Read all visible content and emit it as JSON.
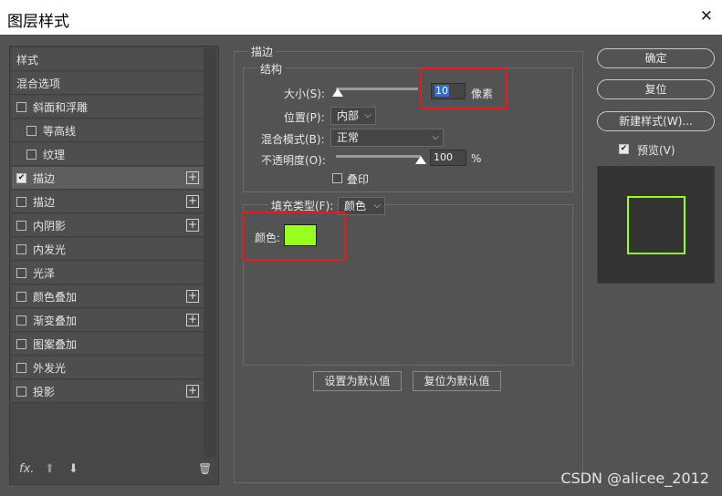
{
  "window": {
    "title": "图层样式",
    "close_glyph": "✕"
  },
  "sidebar": {
    "items": [
      {
        "label": "样式",
        "has_checkbox": false,
        "checked": false,
        "has_plus": false
      },
      {
        "label": "混合选项",
        "has_checkbox": false,
        "checked": false,
        "has_plus": false
      },
      {
        "label": "斜面和浮雕",
        "has_checkbox": true,
        "checked": false,
        "has_plus": false
      },
      {
        "label": "等高线",
        "has_checkbox": true,
        "checked": false,
        "has_plus": false
      },
      {
        "label": "纹理",
        "has_checkbox": true,
        "checked": false,
        "has_plus": false
      },
      {
        "label": "描边",
        "has_checkbox": true,
        "checked": true,
        "has_plus": true
      },
      {
        "label": "描边",
        "has_checkbox": true,
        "checked": false,
        "has_plus": true
      },
      {
        "label": "内阴影",
        "has_checkbox": true,
        "checked": false,
        "has_plus": true
      },
      {
        "label": "内发光",
        "has_checkbox": true,
        "checked": false,
        "has_plus": false
      },
      {
        "label": "光泽",
        "has_checkbox": true,
        "checked": false,
        "has_plus": false
      },
      {
        "label": "颜色叠加",
        "has_checkbox": true,
        "checked": false,
        "has_plus": true
      },
      {
        "label": "渐变叠加",
        "has_checkbox": true,
        "checked": false,
        "has_plus": true
      },
      {
        "label": "图案叠加",
        "has_checkbox": true,
        "checked": false,
        "has_plus": false
      },
      {
        "label": "外发光",
        "has_checkbox": true,
        "checked": false,
        "has_plus": false
      },
      {
        "label": "投影",
        "has_checkbox": true,
        "checked": false,
        "has_plus": true
      }
    ],
    "footer": {
      "fx": "fx.",
      "up": "⬆",
      "down": "⬇",
      "trash": "🗑"
    }
  },
  "stroke": {
    "section_title": "描边",
    "structure": {
      "title": "结构",
      "size_label": "大小(S):",
      "size_value": "10",
      "size_unit": "像素",
      "size_level": 0.02,
      "position_label": "位置(P):",
      "position_value": "内部",
      "blend_label": "混合模式(B):",
      "blend_value": "正常",
      "opacity_label": "不透明度(O):",
      "opacity_value": "100",
      "opacity_unit": "%",
      "opacity_level": 1.0,
      "overprint_label": "叠印"
    },
    "fill": {
      "type_label": "填充类型(F):",
      "type_value": "颜色",
      "color_label": "颜色:",
      "color_hex": "#99ff1f"
    },
    "make_default": "设置为默认值",
    "reset_default": "复位为默认值"
  },
  "actions": {
    "ok": "确定",
    "reset": "复位",
    "new_style": "新建样式(W)...",
    "preview_label": "预览(V)"
  },
  "watermark": "CSDN @alicee_2012",
  "colors": {
    "accent": "#99ff1f",
    "highlight": "#e11d1d",
    "panel": "#535353"
  }
}
